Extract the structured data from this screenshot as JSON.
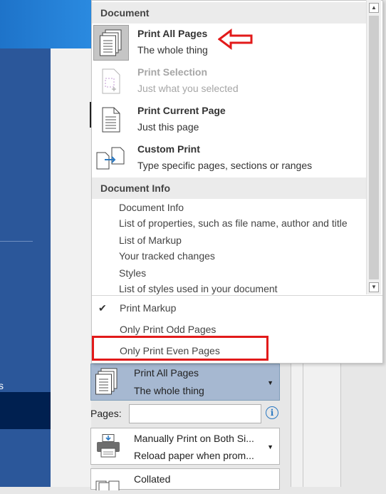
{
  "menu": {
    "document_header": "Document",
    "items": [
      {
        "title": "Print All Pages",
        "subtitle": "The whole thing",
        "icon": "pages-stack-icon",
        "selected": true,
        "enabled": true
      },
      {
        "title": "Print Selection",
        "subtitle": "Just what you selected",
        "icon": "selection-page-icon",
        "selected": false,
        "enabled": false
      },
      {
        "title": "Print Current Page",
        "subtitle": "Just this page",
        "icon": "single-page-icon",
        "selected": false,
        "enabled": true
      },
      {
        "title": "Custom Print",
        "subtitle": "Type specific pages, sections or ranges",
        "icon": "custom-pages-icon",
        "selected": false,
        "enabled": true
      }
    ],
    "document_info_header": "Document Info",
    "info_items": [
      {
        "title": "Document Info",
        "subtitle": "List of properties, such as file name, author and title"
      },
      {
        "title": "List of Markup",
        "subtitle": "Your tracked changes"
      },
      {
        "title": "Styles",
        "subtitle": "List of styles used in your document"
      }
    ],
    "options": [
      {
        "label": "Print Markup",
        "checked": true
      },
      {
        "label": "Only Print Odd Pages",
        "checked": false
      },
      {
        "label": "Only Print Even Pages",
        "checked": false
      }
    ],
    "check_glyph": "✔"
  },
  "settings": {
    "print_select": {
      "title": "Print All Pages",
      "subtitle": "The whole thing"
    },
    "pages_label": "Pages:",
    "pages_value": "",
    "duplex": {
      "title": "Manually Print on Both Si...",
      "subtitle": "Reload paper when prom..."
    },
    "collated": {
      "title": "Collated"
    }
  },
  "left_nav": {
    "partial_letter": "s"
  },
  "colors": {
    "accent": "#2b579a",
    "annotation": "#e21a1a",
    "selected_setting": "#a6b8d1"
  }
}
